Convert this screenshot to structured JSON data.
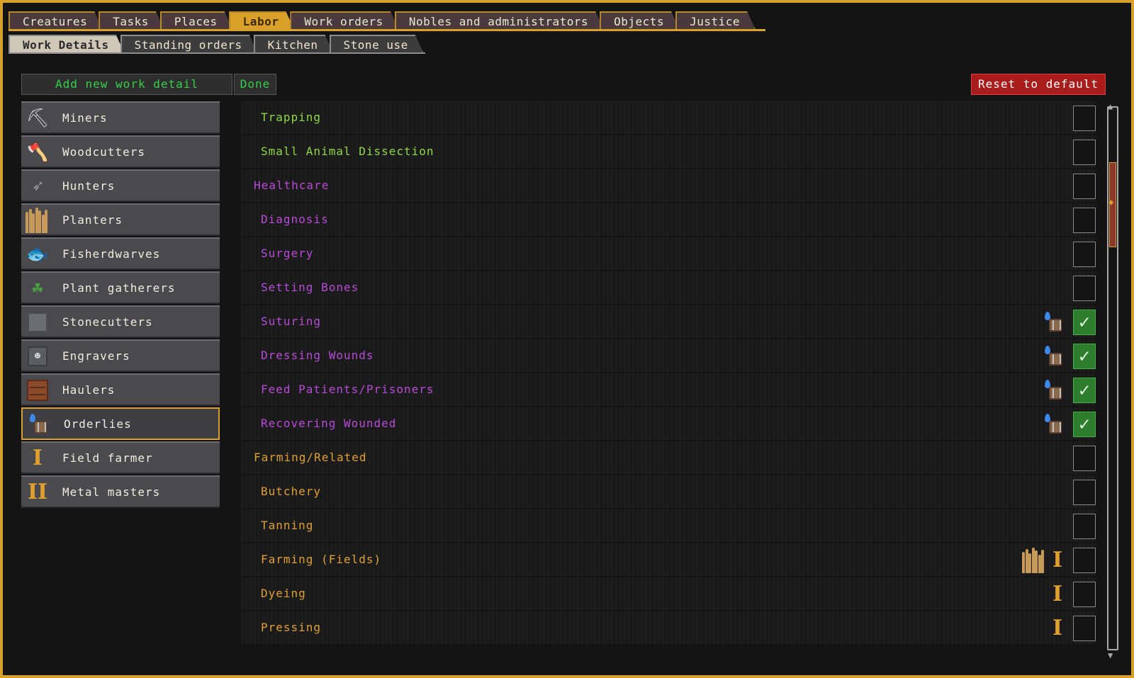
{
  "tabs": {
    "main": [
      "Creatures",
      "Tasks",
      "Places",
      "Labor",
      "Work orders",
      "Nobles and administrators",
      "Objects",
      "Justice"
    ],
    "main_active": "Labor",
    "sub": [
      "Work Details",
      "Standing orders",
      "Kitchen",
      "Stone use"
    ],
    "sub_active": "Work Details"
  },
  "actions": {
    "add_label": "Add new work detail",
    "done_label": "Done",
    "reset_label": "Reset to default"
  },
  "work_details": [
    {
      "label": "Miners",
      "icon": "pickaxe-icon"
    },
    {
      "label": "Woodcutters",
      "icon": "axe-icon"
    },
    {
      "label": "Hunters",
      "icon": "crossbow-icon"
    },
    {
      "label": "Planters",
      "icon": "wheat-icon"
    },
    {
      "label": "Fisherdwarves",
      "icon": "fish-icon"
    },
    {
      "label": "Plant gatherers",
      "icon": "herb-bag-icon"
    },
    {
      "label": "Stonecutters",
      "icon": "stone-block-icon"
    },
    {
      "label": "Engravers",
      "icon": "engraved-stone-icon"
    },
    {
      "label": "Haulers",
      "icon": "crate-icon"
    },
    {
      "label": "Orderlies",
      "icon": "water-bucket-icon",
      "selected": true
    },
    {
      "label": "Field farmer",
      "icon": "roman-one-icon"
    },
    {
      "label": "Metal masters",
      "icon": "roman-two-icon"
    }
  ],
  "labors": [
    {
      "label": "Trapping",
      "color": "#8ed840",
      "category": false,
      "checked": false,
      "icons": []
    },
    {
      "label": "Small Animal Dissection",
      "color": "#8ed840",
      "category": false,
      "checked": false,
      "icons": []
    },
    {
      "label": "Healthcare",
      "color": "#b84ad8",
      "category": true,
      "checked": false,
      "icons": []
    },
    {
      "label": "Diagnosis",
      "color": "#b84ad8",
      "category": false,
      "checked": false,
      "icons": []
    },
    {
      "label": "Surgery",
      "color": "#b84ad8",
      "category": false,
      "checked": false,
      "icons": []
    },
    {
      "label": "Setting Bones",
      "color": "#b84ad8",
      "category": false,
      "checked": false,
      "icons": []
    },
    {
      "label": "Suturing",
      "color": "#b84ad8",
      "category": false,
      "checked": true,
      "icons": [
        "water-bucket-icon"
      ]
    },
    {
      "label": "Dressing Wounds",
      "color": "#b84ad8",
      "category": false,
      "checked": true,
      "icons": [
        "water-bucket-icon"
      ]
    },
    {
      "label": "Feed Patients/Prisoners",
      "color": "#b84ad8",
      "category": false,
      "checked": true,
      "icons": [
        "water-bucket-icon"
      ]
    },
    {
      "label": "Recovering Wounded",
      "color": "#b84ad8",
      "category": false,
      "checked": true,
      "icons": [
        "water-bucket-icon"
      ]
    },
    {
      "label": "Farming/Related",
      "color": "#e0a030",
      "category": true,
      "checked": false,
      "icons": []
    },
    {
      "label": "Butchery",
      "color": "#e0a030",
      "category": false,
      "checked": false,
      "icons": []
    },
    {
      "label": "Tanning",
      "color": "#e0a030",
      "category": false,
      "checked": false,
      "icons": []
    },
    {
      "label": "Farming (Fields)",
      "color": "#e0a030",
      "category": false,
      "checked": false,
      "icons": [
        "wheat-icon",
        "roman-one-icon"
      ]
    },
    {
      "label": "Dyeing",
      "color": "#e0a030",
      "category": false,
      "checked": false,
      "icons": [
        "roman-one-icon"
      ]
    },
    {
      "label": "Pressing",
      "color": "#e0a030",
      "category": false,
      "checked": false,
      "icons": [
        "roman-one-icon"
      ]
    }
  ],
  "scroll": {
    "position_fraction": 0.12
  }
}
